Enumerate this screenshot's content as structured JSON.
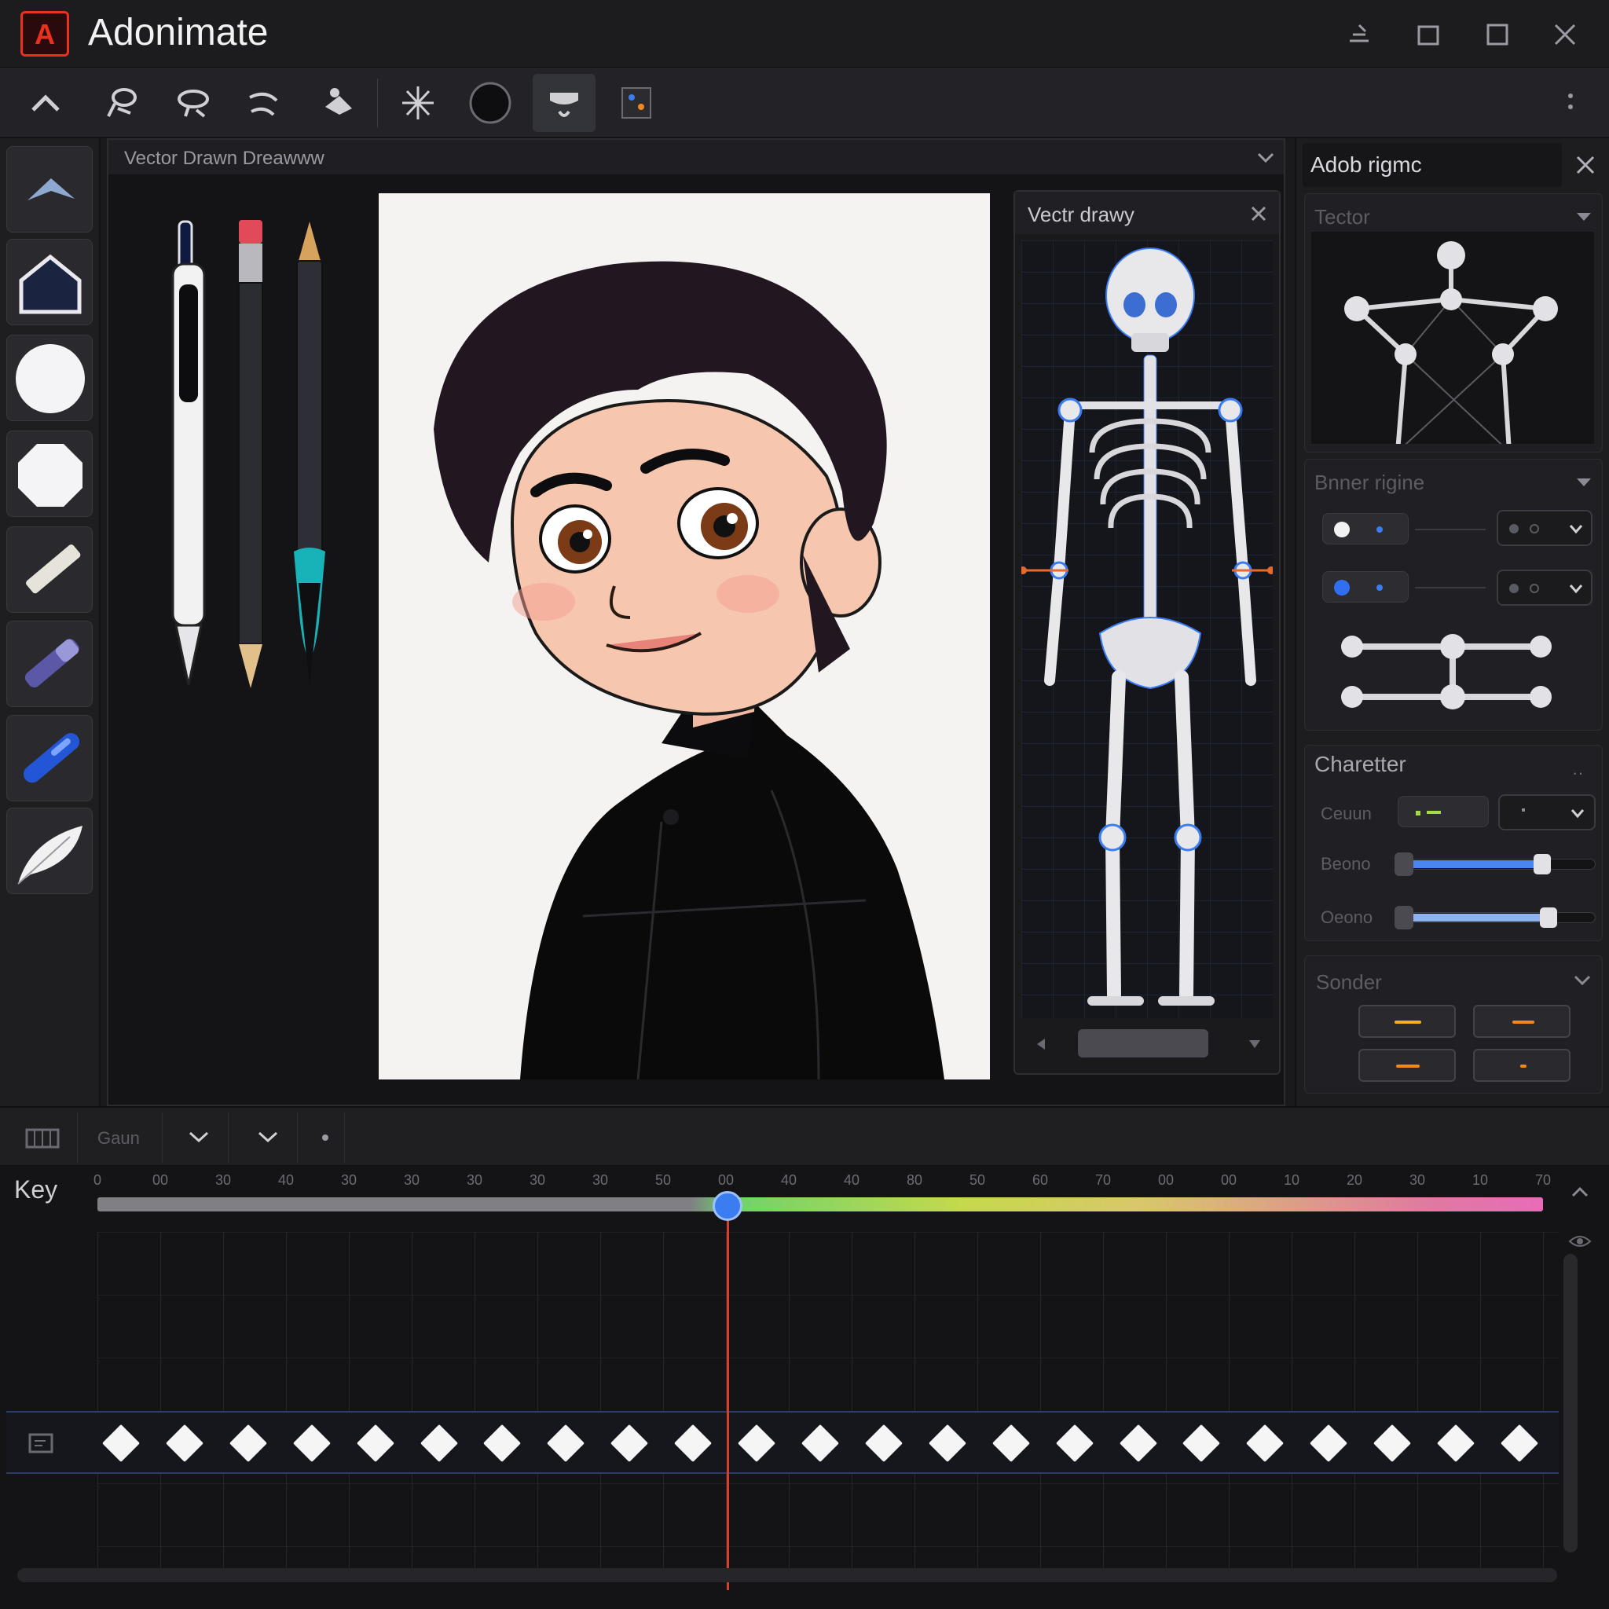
{
  "app": {
    "title": "Adonimate",
    "logo_text": "A"
  },
  "drawing_panel": {
    "tabs": "Vector  Drawn  Dreawww"
  },
  "skeleton_panel": {
    "title": "Vectr drawy"
  },
  "right_panel": {
    "title": "Adob rigmc",
    "sections": {
      "vector": "Tector",
      "bone_rigging": "Bnner rigine",
      "character": "Charetter",
      "controller": "Sonder"
    },
    "character_rows": [
      "Ceuun",
      "Beono",
      "Oeono"
    ],
    "slider_values": [
      0.73,
      0.76
    ]
  },
  "timeline": {
    "key_label": "Key",
    "dropdown_label": "Gaun",
    "ticks": [
      "0",
      "00",
      "30",
      "40",
      "30",
      "30",
      "30",
      "30",
      "30",
      "50",
      "00",
      "40",
      "40",
      "80",
      "50",
      "60",
      "70",
      "00",
      "00",
      "10",
      "20",
      "30",
      "10",
      "70"
    ],
    "keyframe_count": 23,
    "playhead_fraction": 0.436
  },
  "colors": {
    "accent": "#3b7df0",
    "brand": "#e8311f",
    "playhead": "#d5402a",
    "orange": "#f08a1f"
  }
}
